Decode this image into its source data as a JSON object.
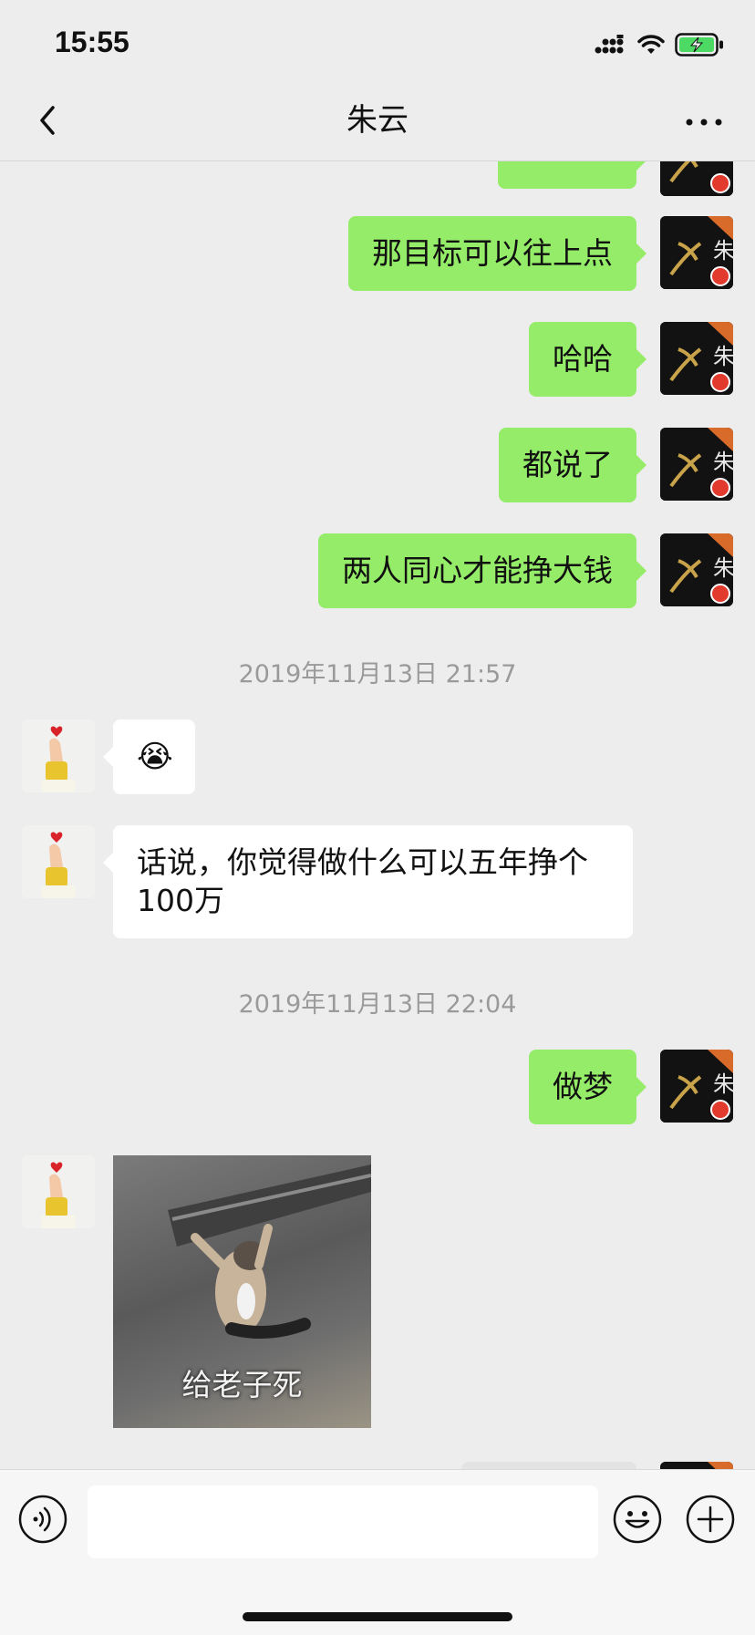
{
  "status_bar": {
    "time": "15:55"
  },
  "nav": {
    "title": "朱云"
  },
  "messages": [
    {
      "side": "me",
      "text": "那目标可以往上点"
    },
    {
      "side": "me",
      "text": "哈哈"
    },
    {
      "side": "me",
      "text": "都说了"
    },
    {
      "side": "me",
      "text": "两人同心才能挣大钱"
    },
    {
      "type": "timestamp",
      "text": "2019年11月13日 21:57"
    },
    {
      "side": "other",
      "emoji": "😭"
    },
    {
      "side": "other",
      "text": "话说，你觉得做什么可以五年挣个100万"
    },
    {
      "type": "timestamp",
      "text": "2019年11月13日 22:04"
    },
    {
      "side": "me",
      "text": "做梦"
    },
    {
      "side": "other",
      "type": "sticker",
      "caption": "给老子死"
    }
  ],
  "avatar_badge": {
    "label": "朱"
  },
  "colors": {
    "sent_bubble": "#95ec69",
    "received_bubble": "#ffffff",
    "background": "#ededed",
    "battery": "#4cd964"
  }
}
